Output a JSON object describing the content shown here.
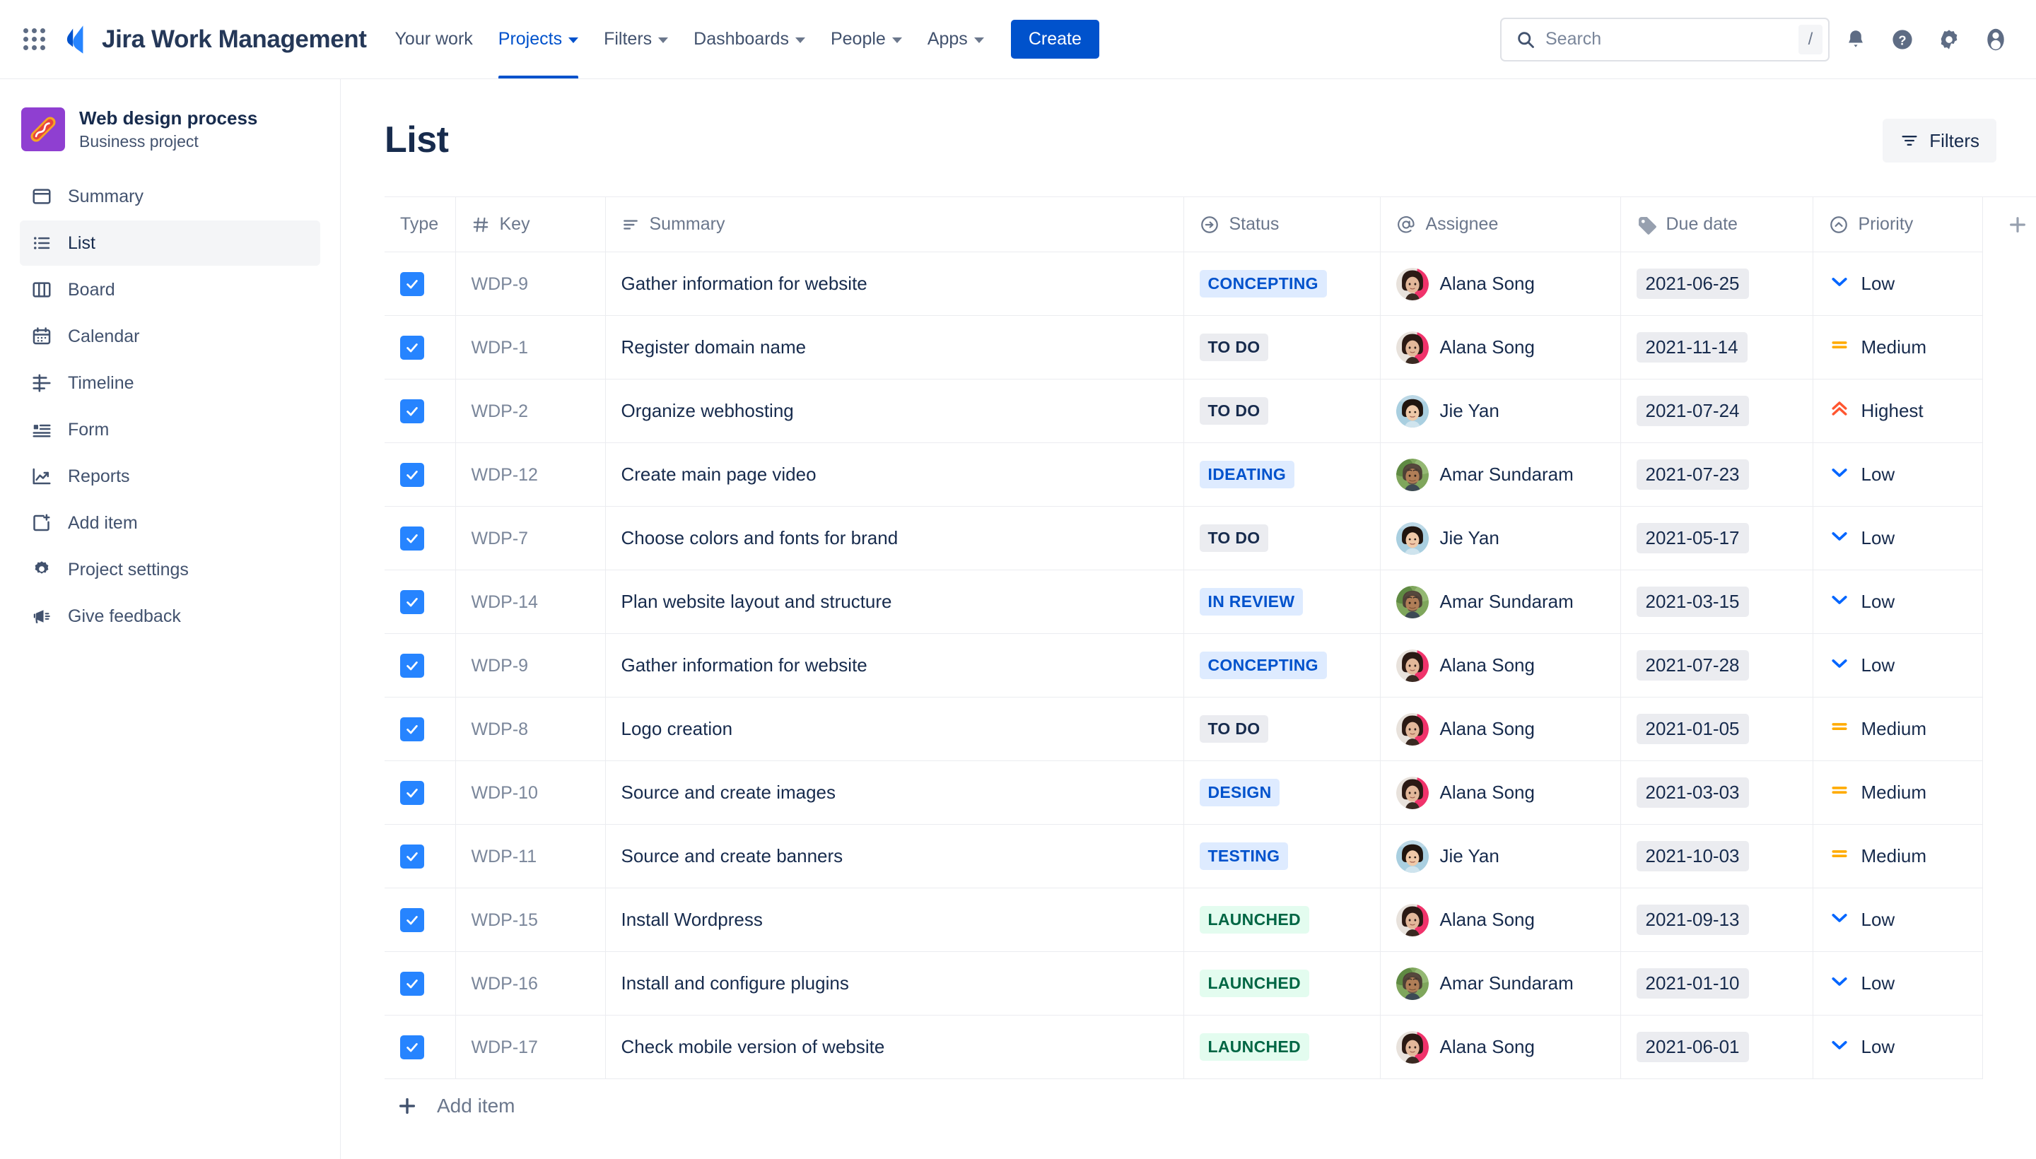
{
  "topnav": {
    "app_switcher_icon": "grid-apps-icon",
    "brand_logo_icon": "jira-logo-icon",
    "brand_title": "Jira Work Management",
    "items": [
      {
        "label": "Your work",
        "has_caret": false,
        "active": false
      },
      {
        "label": "Projects",
        "has_caret": true,
        "active": true
      },
      {
        "label": "Filters",
        "has_caret": true,
        "active": false
      },
      {
        "label": "Dashboards",
        "has_caret": true,
        "active": false
      },
      {
        "label": "People",
        "has_caret": true,
        "active": false
      },
      {
        "label": "Apps",
        "has_caret": true,
        "active": false
      }
    ],
    "create_label": "Create",
    "search": {
      "placeholder": "Search",
      "value": "",
      "shortcut_key": "/",
      "icon": "search-icon"
    },
    "right_icons": [
      {
        "name": "notifications-bell-icon"
      },
      {
        "name": "help-question-icon"
      },
      {
        "name": "settings-gear-icon"
      },
      {
        "name": "user-profile-avatar-icon"
      }
    ]
  },
  "sidebar": {
    "project": {
      "avatar_icon": "hotdog-project-avatar",
      "avatar_color": "#8f3fd1",
      "name": "Web design process",
      "type": "Business project"
    },
    "items": [
      {
        "label": "Summary",
        "icon": "summary-icon",
        "selected": false
      },
      {
        "label": "List",
        "icon": "list-icon",
        "selected": true
      },
      {
        "label": "Board",
        "icon": "board-icon",
        "selected": false
      },
      {
        "label": "Calendar",
        "icon": "calendar-icon",
        "selected": false
      },
      {
        "label": "Timeline",
        "icon": "timeline-icon",
        "selected": false
      },
      {
        "label": "Form",
        "icon": "form-icon",
        "selected": false
      },
      {
        "label": "Reports",
        "icon": "reports-icon",
        "selected": false
      },
      {
        "label": "Add item",
        "icon": "add-item-icon",
        "selected": false
      },
      {
        "label": "Project settings",
        "icon": "project-settings-icon",
        "selected": false
      },
      {
        "label": "Give feedback",
        "icon": "give-feedback-icon",
        "selected": false
      }
    ]
  },
  "main": {
    "page_title": "List",
    "filters_button": {
      "label": "Filters",
      "icon": "filter-icon"
    },
    "add_item": {
      "label": "Add item",
      "icon": "plus-icon"
    },
    "add_column_icon": "plus-icon",
    "columns": [
      {
        "label": "Type",
        "icon": null
      },
      {
        "label": "Key",
        "icon": "hash-icon"
      },
      {
        "label": "Summary",
        "icon": "text-lines-icon"
      },
      {
        "label": "Status",
        "icon": "arrow-right-circle-icon"
      },
      {
        "label": "Assignee",
        "icon": "at-sign-icon"
      },
      {
        "label": "Due date",
        "icon": "tag-icon"
      },
      {
        "label": "Priority",
        "icon": "chevron-up-circle-icon"
      }
    ],
    "rows": [
      {
        "checked": true,
        "key": "WDP-9",
        "summary": "Gather information for website",
        "status": "CONCEPTING",
        "status_tone": "blue",
        "assignee": "Alana Song",
        "avatar": "alana",
        "due": "2021-06-25",
        "priority": "Low",
        "priority_icon": "low-chevron-down"
      },
      {
        "checked": true,
        "key": "WDP-1",
        "summary": "Register domain name",
        "status": "TO DO",
        "status_tone": "gray",
        "assignee": "Alana Song",
        "avatar": "alana",
        "due": "2021-11-14",
        "priority": "Medium",
        "priority_icon": "medium-equals"
      },
      {
        "checked": true,
        "key": "WDP-2",
        "summary": "Organize webhosting",
        "status": "TO DO",
        "status_tone": "gray",
        "assignee": "Jie Yan",
        "avatar": "jie",
        "due": "2021-07-24",
        "priority": "Highest",
        "priority_icon": "highest-double-chevron-up"
      },
      {
        "checked": true,
        "key": "WDP-12",
        "summary": "Create main page video",
        "status": "IDEATING",
        "status_tone": "blue",
        "assignee": "Amar Sundaram",
        "avatar": "amar",
        "due": "2021-07-23",
        "priority": "Low",
        "priority_icon": "low-chevron-down"
      },
      {
        "checked": true,
        "key": "WDP-7",
        "summary": "Choose colors and fonts for brand",
        "status": "TO DO",
        "status_tone": "gray",
        "assignee": "Jie Yan",
        "avatar": "jie",
        "due": "2021-05-17",
        "priority": "Low",
        "priority_icon": "low-chevron-down"
      },
      {
        "checked": true,
        "key": "WDP-14",
        "summary": "Plan website layout and structure",
        "status": "IN REVIEW",
        "status_tone": "blue",
        "assignee": "Amar Sundaram",
        "avatar": "amar",
        "due": "2021-03-15",
        "priority": "Low",
        "priority_icon": "low-chevron-down"
      },
      {
        "checked": true,
        "key": "WDP-9",
        "summary": "Gather information for website",
        "status": "CONCEPTING",
        "status_tone": "blue",
        "assignee": "Alana Song",
        "avatar": "alana",
        "due": "2021-07-28",
        "priority": "Low",
        "priority_icon": "low-chevron-down"
      },
      {
        "checked": true,
        "key": "WDP-8",
        "summary": "Logo creation",
        "status": "TO DO",
        "status_tone": "gray",
        "assignee": "Alana Song",
        "avatar": "alana",
        "due": "2021-01-05",
        "priority": "Medium",
        "priority_icon": "medium-equals"
      },
      {
        "checked": true,
        "key": "WDP-10",
        "summary": "Source and create images",
        "status": "DESIGN",
        "status_tone": "blue",
        "assignee": "Alana Song",
        "avatar": "alana",
        "due": "2021-03-03",
        "priority": "Medium",
        "priority_icon": "medium-equals"
      },
      {
        "checked": true,
        "key": "WDP-11",
        "summary": "Source and create banners",
        "status": "TESTING",
        "status_tone": "blue",
        "assignee": "Jie Yan",
        "avatar": "jie",
        "due": "2021-10-03",
        "priority": "Medium",
        "priority_icon": "medium-equals"
      },
      {
        "checked": true,
        "key": "WDP-15",
        "summary": "Install Wordpress",
        "status": "LAUNCHED",
        "status_tone": "green",
        "assignee": "Alana Song",
        "avatar": "alana",
        "due": "2021-09-13",
        "priority": "Low",
        "priority_icon": "low-chevron-down"
      },
      {
        "checked": true,
        "key": "WDP-16",
        "summary": "Install and configure plugins",
        "status": "LAUNCHED",
        "status_tone": "green",
        "assignee": "Amar Sundaram",
        "avatar": "amar",
        "due": "2021-01-10",
        "priority": "Low",
        "priority_icon": "low-chevron-down"
      },
      {
        "checked": true,
        "key": "WDP-17",
        "summary": "Check mobile version of website",
        "status": "LAUNCHED",
        "status_tone": "green",
        "assignee": "Alana Song",
        "avatar": "alana",
        "due": "2021-06-01",
        "priority": "Low",
        "priority_icon": "low-chevron-down"
      }
    ]
  },
  "colors": {
    "brand_blue": "#0052cc",
    "accent_blue": "#2684ff",
    "status_blue_bg": "#deebff",
    "status_gray_bg": "#ebecf0",
    "status_green_bg": "#e3fcef",
    "status_green_text": "#006644",
    "priority_low": "#0065ff",
    "priority_medium": "#ffab00",
    "priority_highest": "#ff5630"
  }
}
